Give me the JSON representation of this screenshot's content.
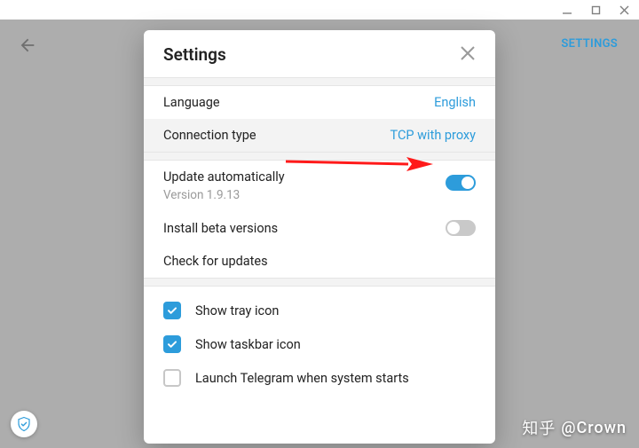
{
  "window": {
    "settings_link": "SETTINGS"
  },
  "modal": {
    "title": "Settings",
    "sections": {
      "language": {
        "label": "Language",
        "value": "English"
      },
      "connection": {
        "label": "Connection type",
        "value": "TCP with proxy"
      },
      "update_auto": {
        "label": "Update automatically",
        "version": "Version 1.9.13",
        "enabled": true
      },
      "install_beta": {
        "label": "Install beta versions",
        "enabled": false
      },
      "check_updates": {
        "label": "Check for updates"
      },
      "show_tray": {
        "label": "Show tray icon",
        "checked": true
      },
      "show_taskbar": {
        "label": "Show taskbar icon",
        "checked": true
      },
      "launch_startup": {
        "label": "Launch Telegram when system starts",
        "checked": false
      }
    }
  },
  "watermark": {
    "zh": "知乎",
    "handle": "@Crown"
  },
  "colors": {
    "accent": "#2d9cdb",
    "annotation": "#ff1a1a"
  }
}
